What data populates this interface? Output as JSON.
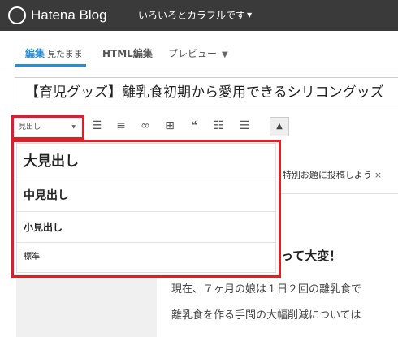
{
  "header": {
    "app_title": "Hatena Blog",
    "blog_name": "いろいろとカラフルです",
    "blog_menu_caret_icon": "triangle-down-icon"
  },
  "tabs": {
    "edit": {
      "label": "編集",
      "mode": "見たまま"
    },
    "html": {
      "label": "HTML編集"
    },
    "preview": {
      "label": "プレビュー",
      "icon": "chevron-down-icon"
    }
  },
  "title_field": {
    "value": "【育児グッズ】離乳食初期から愛用できるシリコングッズ"
  },
  "toolbar": {
    "heading_select": {
      "value": "見出し"
    },
    "icons": [
      "unordered-list-icon",
      "ordered-list-icon",
      "link-icon",
      "table-icon",
      "quote-icon",
      "definition-list-icon",
      "more-icon",
      "collapse-icon"
    ]
  },
  "heading_dropdown": {
    "items": [
      "大見出し",
      "中見出し",
      "小見出し",
      "標準"
    ]
  },
  "notice": {
    "text": "! 特別お題に投稿しよう",
    "close": "×"
  },
  "editor": {
    "heading_visible": "って大変！",
    "para1": "現在、７ヶ月の娘は１日２回の離乳食で",
    "para2": "離乳食を作る手間の大幅削減については"
  },
  "colors": {
    "topbar": "#3a3a3a",
    "accent": "#2b8ed1",
    "highlight": "#e01e26"
  }
}
